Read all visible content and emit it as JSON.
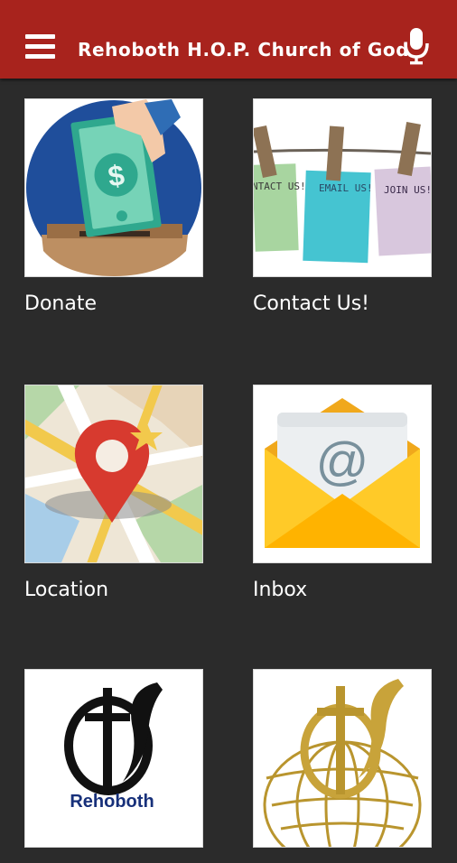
{
  "header": {
    "title": "Rehoboth H.O.P. Church of God",
    "menu_icon": "hamburger-menu-icon",
    "voice_icon": "microphone-icon",
    "background_color": "#a8231d"
  },
  "tiles": [
    {
      "label": "Donate",
      "icon": "donate-icon"
    },
    {
      "label": "Contact Us!",
      "icon": "contact-us-icon"
    },
    {
      "label": "Location",
      "icon": "map-pin-icon"
    },
    {
      "label": "Inbox",
      "icon": "envelope-icon"
    },
    {
      "label": "",
      "icon": "rehoboth-logo-icon"
    },
    {
      "label": "",
      "icon": "church-globe-logo-icon"
    }
  ],
  "images": {
    "contact_notes": [
      "NTACT US!",
      "EMAIL US!",
      "JOIN US!"
    ],
    "logo_text": "Rehoboth",
    "donate_symbol": "$",
    "inbox_symbol": "@"
  }
}
